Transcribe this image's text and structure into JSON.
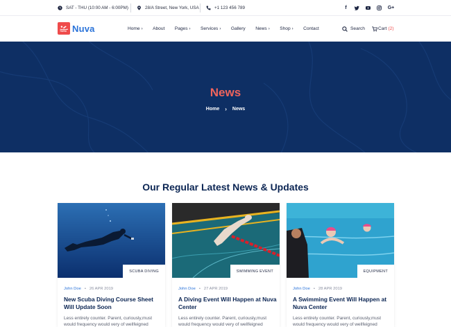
{
  "topbar": {
    "hours": "SAT - THU (10:00 AM - 6:00PM)",
    "address": "28/A Street, New York, USA",
    "phone": "+1 123 456 789",
    "socials": [
      "facebook-icon",
      "twitter-icon",
      "youtube-icon",
      "instagram-icon",
      "google-plus-icon"
    ]
  },
  "header": {
    "logo_text": "Nuva",
    "nav": [
      {
        "label": "Home",
        "has_dropdown": true
      },
      {
        "label": "About",
        "has_dropdown": false
      },
      {
        "label": "Pages",
        "has_dropdown": true
      },
      {
        "label": "Services",
        "has_dropdown": true
      },
      {
        "label": "Gallery",
        "has_dropdown": false
      },
      {
        "label": "News",
        "has_dropdown": true
      },
      {
        "label": "Shop",
        "has_dropdown": true
      },
      {
        "label": "Contact",
        "has_dropdown": false
      }
    ],
    "search_label": "Search",
    "cart_label": "Cart",
    "cart_count": "(2)"
  },
  "hero": {
    "title": "News",
    "breadcrumb": {
      "home": "Home",
      "current": "News"
    }
  },
  "section": {
    "title": "Our Regular Latest News & Updates"
  },
  "cards": [
    {
      "tag": "SCUBA DIVING",
      "author": "John Doe",
      "date": "26 APR 2019",
      "title": "New Scuba Diving Course Sheet Will Update Soon",
      "excerpt": "Less entirely counter. Parent, curiously,must would frequency would very of wellfeigned"
    },
    {
      "tag": "SWIMMING EVENT",
      "author": "John Doe",
      "date": "27 APR 2019",
      "title": "A Diving Event Will Happen at Nuva Center",
      "excerpt": "Less entirely counter. Parent, curiously,must would frequency would very of wellfeigned"
    },
    {
      "tag": "EQUIPMENT",
      "author": "John Doe",
      "date": "28 APR 2019",
      "title": "A Swimming Event Will Happen at Nuva Center",
      "excerpt": "Less entirely counter. Parent, curiously,must would frequency would very of wellfeigned"
    }
  ],
  "colors": {
    "accent": "#ef4b4b",
    "brand_blue": "#2a73d9",
    "hero_bg": "#0e2f64",
    "heading": "#0b2553"
  }
}
